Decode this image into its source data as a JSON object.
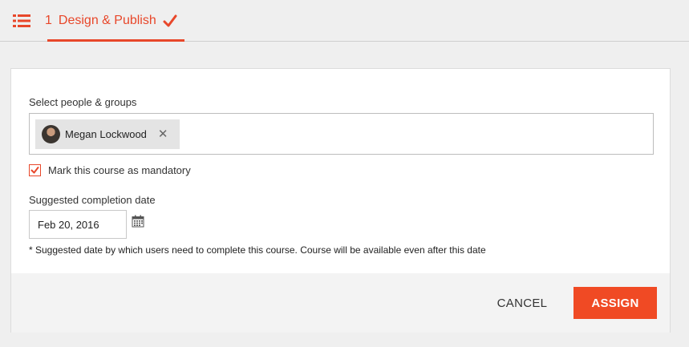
{
  "header": {
    "step_number": "1",
    "step_title": "Design & Publish",
    "menu_icon": "list-icon",
    "status_icon": "checkmark-icon",
    "accent_color": "#e8472a"
  },
  "form": {
    "people_label": "Select people & groups",
    "selected_people": [
      {
        "name": "Megan Lockwood",
        "remove_icon": "close-icon"
      }
    ],
    "mandatory": {
      "label": "Mark this course as mandatory",
      "checked": true
    },
    "date_label": "Suggested completion date",
    "date_value": "Feb 20, 2016",
    "date_icon": "calendar-icon",
    "note": "* Suggested date by which users need to complete this course. Course will be available even after this date"
  },
  "actions": {
    "cancel_label": "CANCEL",
    "assign_label": "ASSIGN",
    "assign_color": "#f04a24"
  }
}
